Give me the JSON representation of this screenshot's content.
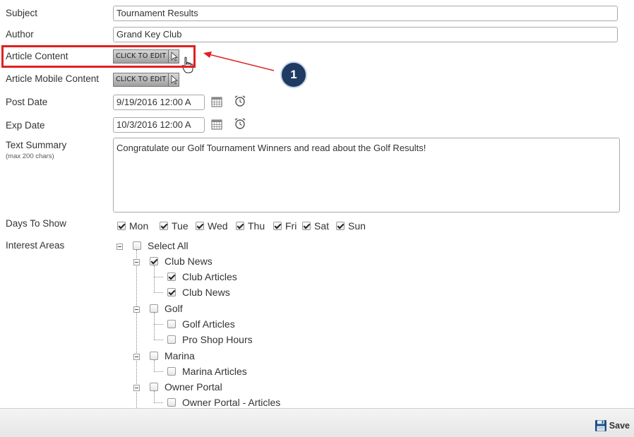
{
  "fields": {
    "subject": {
      "label": "Subject",
      "value": "Tournament Results"
    },
    "author": {
      "label": "Author",
      "value": "Grand Key Club"
    },
    "article_content": {
      "label": "Article Content",
      "button": "CLICK TO EDIT"
    },
    "article_mobile_content": {
      "label": "Article Mobile Content",
      "button": "CLICK TO EDIT"
    },
    "post_date": {
      "label": "Post Date",
      "value": "9/19/2016 12:00 A"
    },
    "exp_date": {
      "label": "Exp Date",
      "value": "10/3/2016 12:00 A"
    },
    "text_summary": {
      "label": "Text Summary",
      "sublabel": "(max 200 chars)",
      "value": "Congratulate our Golf Tournament Winners and read about the Golf Results!"
    },
    "days_to_show": {
      "label": "Days To Show"
    },
    "interest_areas": {
      "label": "Interest Areas"
    }
  },
  "days": [
    {
      "label": "Mon",
      "checked": true
    },
    {
      "label": "Tue",
      "checked": true
    },
    {
      "label": "Wed",
      "checked": true
    },
    {
      "label": "Thu",
      "checked": true
    },
    {
      "label": "Fri",
      "checked": true
    },
    {
      "label": "Sat",
      "checked": true
    },
    {
      "label": "Sun",
      "checked": true
    }
  ],
  "tree": {
    "select_all": "Select All",
    "club_news": "Club News",
    "club_articles": "Club Articles",
    "club_news_child": "Club News",
    "golf": "Golf",
    "golf_articles": "Golf Articles",
    "pro_shop_hours": "Pro Shop Hours",
    "marina": "Marina",
    "marina_articles": "Marina Articles",
    "owner_portal": "Owner Portal",
    "owner_portal_articles": "Owner Portal - Articles"
  },
  "annotation": {
    "step": "1",
    "highlight_color": "#e02020",
    "badge_color": "#1f3a63"
  },
  "footer": {
    "save_label": "Save"
  }
}
